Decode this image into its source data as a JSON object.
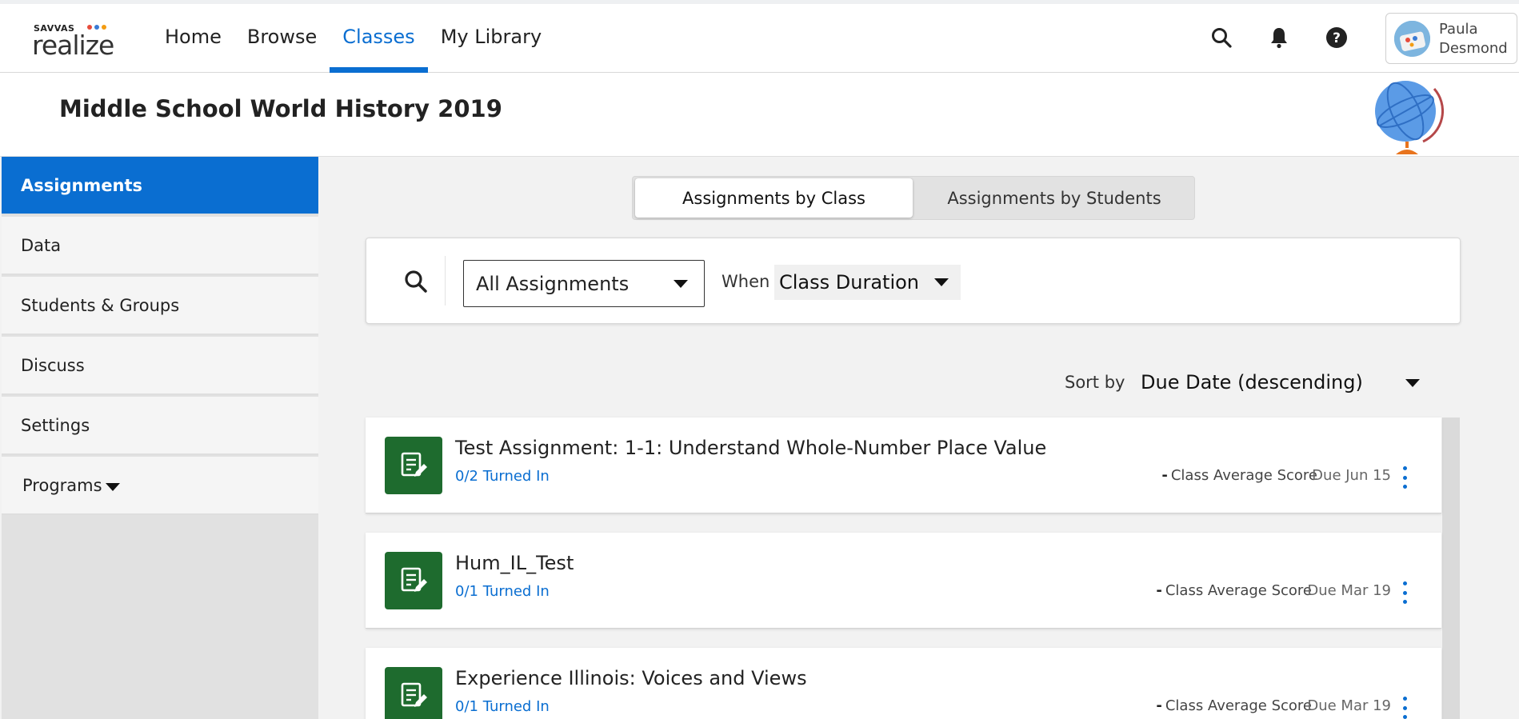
{
  "brand": {
    "savvas": "SAVVAS",
    "realize": "realize",
    "dot_colors": [
      "#e74c3c",
      "#3a7bd5",
      "#f39c12",
      "#27ae60"
    ]
  },
  "nav": {
    "items": [
      {
        "label": "Home",
        "active": false
      },
      {
        "label": "Browse",
        "active": false
      },
      {
        "label": "Classes",
        "active": true
      },
      {
        "label": "My Library",
        "active": false
      }
    ],
    "icons": [
      "search-icon",
      "bell-icon",
      "help-icon"
    ]
  },
  "user": {
    "first_name": "Paula",
    "last_name": "Desmond"
  },
  "class_header": {
    "title": "Middle School World History 2019",
    "image": "globe-icon"
  },
  "sidebar": {
    "items": [
      {
        "label": "Assignments",
        "active": true
      },
      {
        "label": "Data",
        "active": false
      },
      {
        "label": "Students & Groups",
        "active": false
      },
      {
        "label": "Discuss",
        "active": false
      },
      {
        "label": "Settings",
        "active": false
      },
      {
        "label": "Programs",
        "active": false,
        "has_dropdown": true
      }
    ]
  },
  "toggle": {
    "by_class": "Assignments by Class",
    "by_students": "Assignments by Students",
    "selected": "Assignments by Class"
  },
  "filters": {
    "assignment_type": "All Assignments",
    "when_label": "When",
    "when_value": "Class Duration"
  },
  "sort": {
    "label": "Sort by",
    "value": "Due Date (descending)"
  },
  "assignments": [
    {
      "title": "Test Assignment: 1-1: Understand Whole-Number Place Value",
      "turned_in": "0/2 Turned In",
      "score_dash": "-",
      "score_label": "Class Average Score",
      "due": "Due Jun 15"
    },
    {
      "title": "Hum_IL_Test",
      "turned_in": "0/1 Turned In",
      "score_dash": "-",
      "score_label": "Class Average Score",
      "due": "Due Mar 19"
    },
    {
      "title": "Experience Illinois: Voices and Views",
      "turned_in": "0/1 Turned In",
      "score_dash": "-",
      "score_label": "Class Average Score",
      "due": "Due Mar 19"
    }
  ],
  "colors": {
    "accent": "#0a6ed1",
    "assignment_icon": "#1e6b2e"
  }
}
